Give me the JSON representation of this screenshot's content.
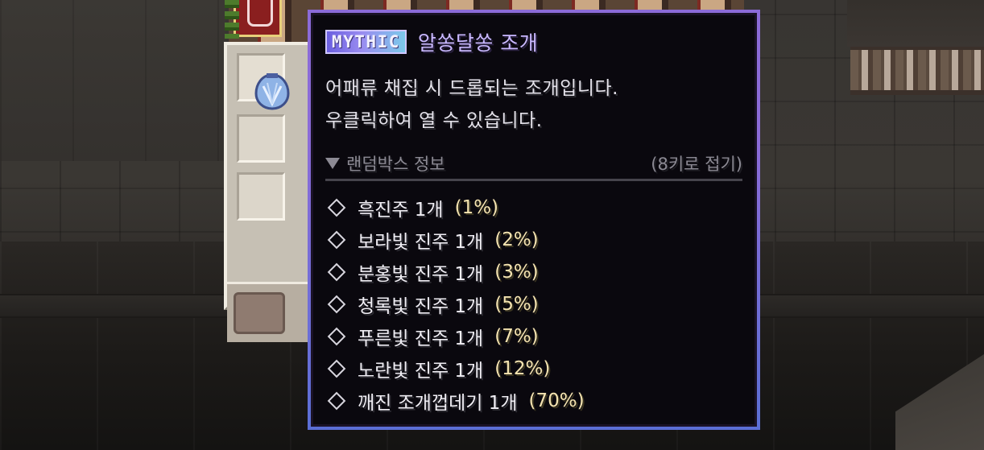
{
  "tooltip": {
    "rarity": "MYTHIC",
    "item_name": "알쏭달쏭 조개",
    "description": [
      "어패류 채집 시 드롭되는 조개입니다.",
      "우클릭하여 열 수 있습니다."
    ],
    "section": {
      "title": "랜덤박스 정보",
      "hint": "(8키로 접기)",
      "icon": "triangle-down-icon"
    },
    "drops": [
      {
        "name": "흑진주 1개",
        "chance": "(1%)"
      },
      {
        "name": "보라빛 진주 1개",
        "chance": "(2%)"
      },
      {
        "name": "분홍빛 진주 1개",
        "chance": "(3%)"
      },
      {
        "name": "청록빛 진주 1개",
        "chance": "(5%)"
      },
      {
        "name": "푸른빛 진주 1개",
        "chance": "(7%)"
      },
      {
        "name": "노란빛 진주 1개",
        "chance": "(12%)"
      },
      {
        "name": "깨진 조개껍데기 1개",
        "chance": "(70%)"
      }
    ],
    "bullet_icon": "diamond-outline-icon"
  },
  "inventory": {
    "hovered_item_icon": "clam-shell-icon"
  },
  "colors": {
    "tooltip_border": "#8b6bd8",
    "item_name": "#c9b8ff",
    "chance_text": "#f4e3b0",
    "rarity_badge": "#9a8cf0"
  }
}
